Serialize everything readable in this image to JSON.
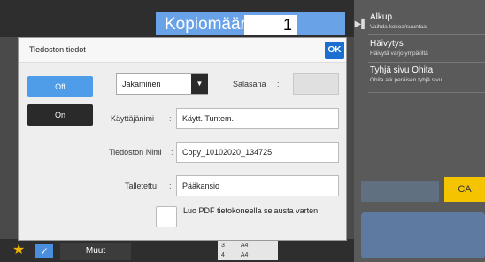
{
  "header": {
    "copies_label": "Kopiomäärä",
    "copies_value": "1"
  },
  "right_panel": {
    "items": [
      {
        "title": "Alkup.",
        "subtitle": "Vaihda kokoa/suuntaa"
      },
      {
        "title": "Häivytys",
        "subtitle": "Häivytä varjo ympäriltä"
      },
      {
        "title": "Tyhjä sivu Ohita",
        "subtitle": "Ohita alk.peräisen tyhjä sivu"
      }
    ],
    "ca_label": "CA"
  },
  "bottom": {
    "more_label": "Muut",
    "paper_slots": [
      {
        "num": "3",
        "size": "A4"
      },
      {
        "num": "4",
        "size": "A4"
      }
    ]
  },
  "dialog": {
    "title": "Tiedoston tiedot",
    "ok_label": "OK",
    "toggle_off": "Off",
    "toggle_on": "On",
    "mode_select": "Jakaminen",
    "password_label": "Salasana",
    "username_label": "Käyttäjänimi",
    "username_value": "Käytt. Tuntem.",
    "filename_label": "Tiedoston Nimi",
    "filename_value": "Copy_10102020_134725",
    "saved_label": "Talletettu",
    "saved_value": "Pääkansio",
    "pdf_checkbox_label": "Luo PDF tietokoneella selausta varten",
    "pdf_checked": false
  },
  "colors": {
    "accent": "#1a6fd1",
    "toggle_active": "#4f9de8",
    "ca": "#f5c400"
  }
}
